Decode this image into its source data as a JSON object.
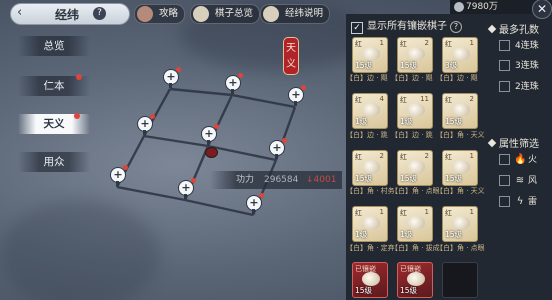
{
  "header": {
    "title": "经纬",
    "help": "?"
  },
  "top_buttons": [
    {
      "label": "攻略",
      "icon": "avatar-icon"
    },
    {
      "label": "棋子总览",
      "icon": "scroll-icon"
    },
    {
      "label": "经纬说明",
      "icon": "scroll-icon"
    }
  ],
  "menu": [
    {
      "label": "总览",
      "badge": false,
      "active": false
    },
    {
      "label": "仁本",
      "badge": true,
      "active": false
    },
    {
      "label": "天义",
      "badge": true,
      "active": true
    },
    {
      "label": "用众",
      "badge": false,
      "active": false
    }
  ],
  "seal_text": "天义",
  "power": {
    "label": "功力",
    "value": "296584",
    "delta": "↓4001"
  },
  "currency": {
    "value": "7980万"
  },
  "panel": {
    "show_all_label": "显示所有镶嵌棋子",
    "show_all_checked": true,
    "cards": [
      {
        "kind": "红",
        "level": "15级",
        "level2": "1",
        "state": "normal"
      },
      {
        "kind": "红",
        "level": "15级",
        "level2": "2",
        "state": "normal"
      },
      {
        "kind": "红",
        "level": "3级",
        "level2": "1",
        "state": "normal"
      },
      {
        "kind": "红",
        "level": "1级",
        "level2": "4",
        "state": "normal"
      },
      {
        "kind": "红",
        "level": "1级",
        "level2": "11",
        "state": "normal"
      },
      {
        "kind": "红",
        "level": "15级",
        "level2": "2",
        "state": "normal"
      },
      {
        "kind": "红",
        "level": "15级",
        "level2": "2",
        "state": "normal"
      },
      {
        "kind": "红",
        "level": "15级",
        "level2": "2",
        "state": "normal"
      },
      {
        "kind": "红",
        "level": "15级",
        "level2": "1",
        "state": "normal"
      },
      {
        "kind": "红",
        "level": "1级",
        "level2": "1",
        "state": "normal"
      },
      {
        "kind": "红",
        "level": "1级",
        "level2": "1",
        "state": "normal"
      },
      {
        "kind": "红",
        "level": "15级",
        "level2": "1",
        "state": "normal"
      },
      {
        "kind": "已镶嵌",
        "level": "15级",
        "level2": "",
        "state": "equipped"
      },
      {
        "kind": "已镶嵌",
        "level": "15级",
        "level2": "",
        "state": "equipped"
      },
      {
        "kind": "",
        "level": "",
        "level2": "",
        "state": "empty"
      }
    ],
    "captions": [
      [
        "【白】边 · 飓",
        "【白】边 · 飓",
        "【白】边 · 飓"
      ],
      [
        "【白】边 · 跳",
        "【白】边 · 跳",
        "【白】角 · 天义"
      ],
      [
        "【白】角 · 村务",
        "【白】角 · 点眼",
        "【白】角 · 天义"
      ],
      [
        "【白】角 · 定弃",
        "【白】角 · 拔成",
        "【白】角 · 点眼"
      ]
    ]
  },
  "filters": {
    "holes_title": "最多孔数",
    "holes": [
      "4连珠",
      "3连珠",
      "2连珠"
    ],
    "attr_title": "属性筛选",
    "attrs": [
      {
        "label": "火",
        "icon": "fire-icon"
      },
      {
        "label": "风",
        "icon": "wind-icon"
      },
      {
        "label": "雷",
        "icon": "lightning-icon"
      }
    ]
  }
}
